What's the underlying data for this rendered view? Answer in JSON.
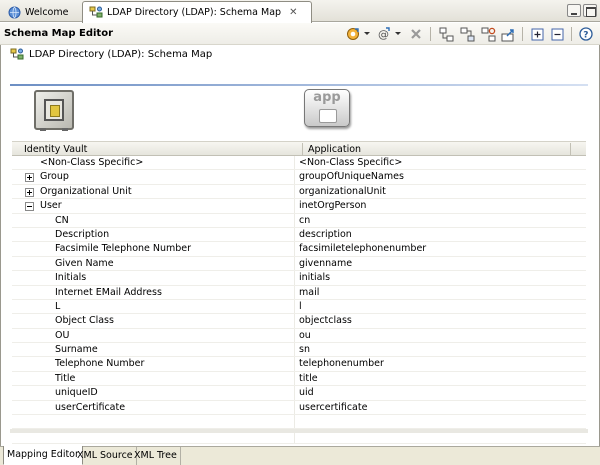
{
  "tabs": [
    {
      "label": "Welcome",
      "icon": "welcome-globe-icon",
      "active": false
    },
    {
      "label": "LDAP Directory (LDAP): Schema Map",
      "icon": "schema-map-icon",
      "active": true,
      "close_icon": "close-icon"
    }
  ],
  "editor": {
    "title": "Schema Map Editor",
    "subtitle": "LDAP Directory (LDAP): Schema Map"
  },
  "toolbar": {
    "icons": [
      "add-class-icon",
      "add-attribute-icon",
      "delete-icon",
      "map-left-icon",
      "map-right-icon",
      "refresh-icon",
      "export-icon",
      "expand-all-icon",
      "collapse-all-icon",
      "help-icon"
    ]
  },
  "panel": {
    "vault_icon": "identity-vault-icon",
    "app_icon_text": "app"
  },
  "table": {
    "columns": [
      "Identity Vault",
      "Application"
    ],
    "rows": [
      {
        "vault": "<Non-Class Specific>",
        "app": "<Non-Class Specific>",
        "level": 0,
        "expander": "none"
      },
      {
        "vault": "Group",
        "app": "groupOfUniqueNames",
        "level": 0,
        "expander": "plus"
      },
      {
        "vault": "Organizational Unit",
        "app": "organizationalUnit",
        "level": 0,
        "expander": "plus"
      },
      {
        "vault": "User",
        "app": "inetOrgPerson",
        "level": 0,
        "expander": "minus"
      },
      {
        "vault": "CN",
        "app": "cn",
        "level": 1,
        "expander": "none"
      },
      {
        "vault": "Description",
        "app": "description",
        "level": 1,
        "expander": "none"
      },
      {
        "vault": "Facsimile Telephone Number",
        "app": "facsimiletelephonenumber",
        "level": 1,
        "expander": "none"
      },
      {
        "vault": "Given Name",
        "app": "givenname",
        "level": 1,
        "expander": "none"
      },
      {
        "vault": "Initials",
        "app": "initials",
        "level": 1,
        "expander": "none"
      },
      {
        "vault": "Internet EMail Address",
        "app": "mail",
        "level": 1,
        "expander": "none"
      },
      {
        "vault": "L",
        "app": "l",
        "level": 1,
        "expander": "none"
      },
      {
        "vault": "Object Class",
        "app": "objectclass",
        "level": 1,
        "expander": "none"
      },
      {
        "vault": "OU",
        "app": "ou",
        "level": 1,
        "expander": "none"
      },
      {
        "vault": "Surname",
        "app": "sn",
        "level": 1,
        "expander": "none"
      },
      {
        "vault": "Telephone Number",
        "app": "telephonenumber",
        "level": 1,
        "expander": "none"
      },
      {
        "vault": "Title",
        "app": "title",
        "level": 1,
        "expander": "none"
      },
      {
        "vault": "uniqueID",
        "app": "uid",
        "level": 1,
        "expander": "none"
      },
      {
        "vault": "userCertificate",
        "app": "usercertificate",
        "level": 1,
        "expander": "none"
      }
    ]
  },
  "bottom_tabs": [
    {
      "label": "Mapping Editor",
      "active": true
    },
    {
      "label": "XML Source",
      "active": false
    },
    {
      "label": "XML Tree",
      "active": false
    }
  ],
  "colors": {
    "accent_line": "#6d8fc4",
    "tab_background": "#ece9d8"
  }
}
